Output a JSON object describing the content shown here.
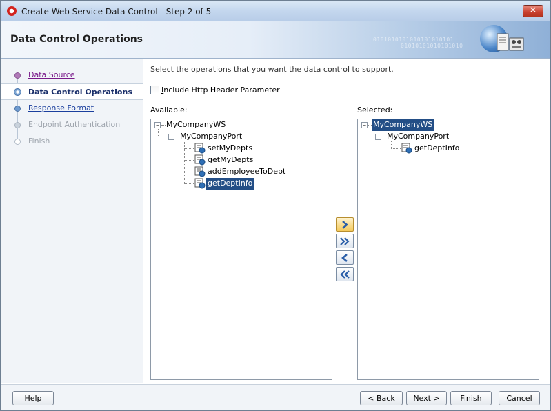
{
  "window": {
    "title": "Create Web Service Data Control - Step 2 of 5",
    "close_glyph": "✕"
  },
  "header": {
    "title": "Data Control Operations",
    "decoration": "0101010101010101010101\n01010101010101010"
  },
  "nav": {
    "items": [
      {
        "label": "Data Source",
        "state": "visited"
      },
      {
        "label": "Data Control Operations",
        "state": "active"
      },
      {
        "label": "Response Format ",
        "state": "link"
      },
      {
        "label": "Endpoint Authentication",
        "state": "disabled"
      },
      {
        "label": "Finish",
        "state": "disabled"
      }
    ]
  },
  "main": {
    "instructions": "Select the operations that you want the data control to support.",
    "include_header": {
      "label": "Include Http Header Parameter",
      "checked": false
    },
    "available_label": "Available:",
    "selected_label": "Selected:"
  },
  "available_tree": {
    "service": "MyCompanyWS",
    "port": "MyCompanyPort",
    "operations": [
      "setMyDepts",
      "getMyDepts",
      "addEmployeeToDept",
      "getDeptInfo"
    ],
    "selected_operation": "getDeptInfo"
  },
  "selected_tree": {
    "service": "MyCompanyWS",
    "port": "MyCompanyPort",
    "operations": [
      "getDeptInfo"
    ],
    "selected_node": "MyCompanyWS"
  },
  "shuttle": {
    "add": "Add",
    "add_all": "Add All",
    "remove": "Remove",
    "remove_all": "Remove All"
  },
  "footer": {
    "help": "Help",
    "back": "< Back",
    "next": "Next >",
    "finish": "Finish",
    "cancel": "Cancel"
  },
  "colors": {
    "selection": "#234e86",
    "nav_background": "#f1f4f8",
    "link": "#1b3f9e"
  }
}
